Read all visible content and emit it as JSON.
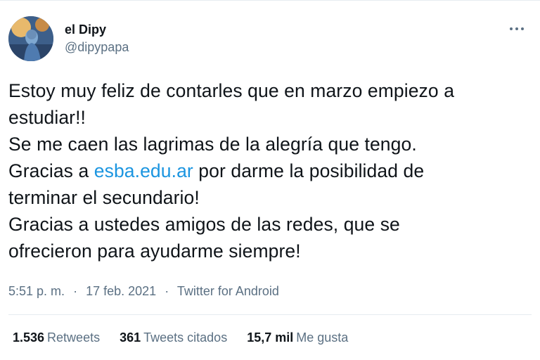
{
  "tweet": {
    "author": {
      "display_name": "el Dipy",
      "handle": "@dipypapa"
    },
    "text_lines": {
      "l1": "Estoy muy feliz de contarles que en marzo empiezo a",
      "l2": "estudiar!!",
      "l3": "Se me caen las lagrimas de la alegría que tengo.",
      "l4_before": "Gracias a ",
      "l4_link": "esba.edu.ar",
      "l4_after": " por darme la posibilidad de",
      "l5": "terminar el secundario!",
      "l6": "Gracias a ustedes amigos de las redes, que se",
      "l7": "ofrecieron para ayudarme siempre!"
    },
    "meta": {
      "time": "5:51 p. m.",
      "separator": "·",
      "date": "17 feb. 2021",
      "source": "Twitter for Android"
    },
    "stats": {
      "retweets_count": "1.536",
      "retweets_label": "Retweets",
      "quotes_count": "361",
      "quotes_label": "Tweets citados",
      "likes_count": "15,7 mil",
      "likes_label": "Me gusta"
    }
  },
  "colors": {
    "link": "#1b95e0",
    "secondary_text": "#5b7083",
    "primary_text": "#0f1419",
    "divider": "#e6ecf0"
  },
  "icons": {
    "more": "more-horizontal-icon"
  }
}
